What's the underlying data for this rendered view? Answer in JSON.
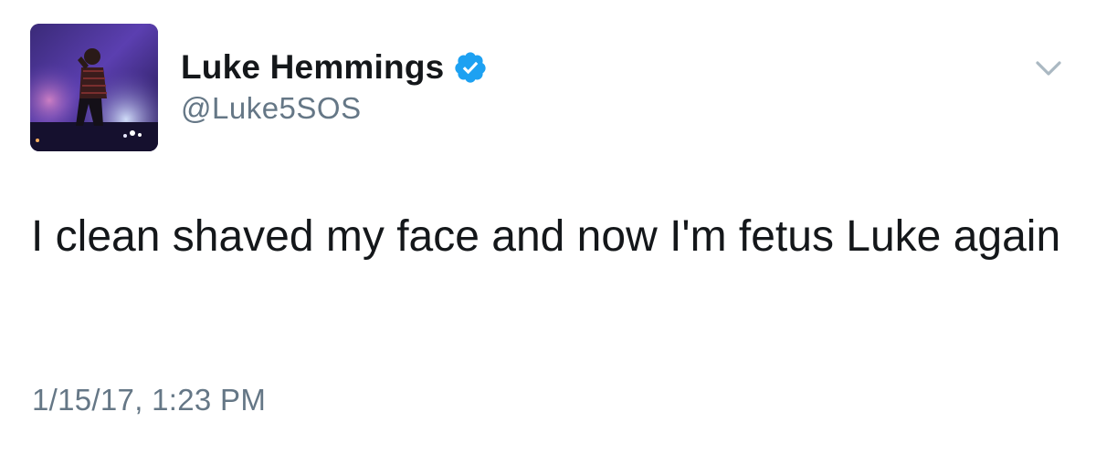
{
  "tweet": {
    "author": {
      "display_name": "Luke Hemmings",
      "handle": "@Luke5SOS",
      "verified": true,
      "avatar_icon": "avatar-concert-photo"
    },
    "menu_icon": "chevron-down-icon",
    "text": "I clean shaved my face and now I'm fetus Luke again",
    "timestamp": "1/15/17, 1:23 PM"
  },
  "colors": {
    "text_primary": "#14171a",
    "text_secondary": "#657786",
    "verified_blue": "#1da1f2",
    "caret_gray": "#aab8c2"
  }
}
